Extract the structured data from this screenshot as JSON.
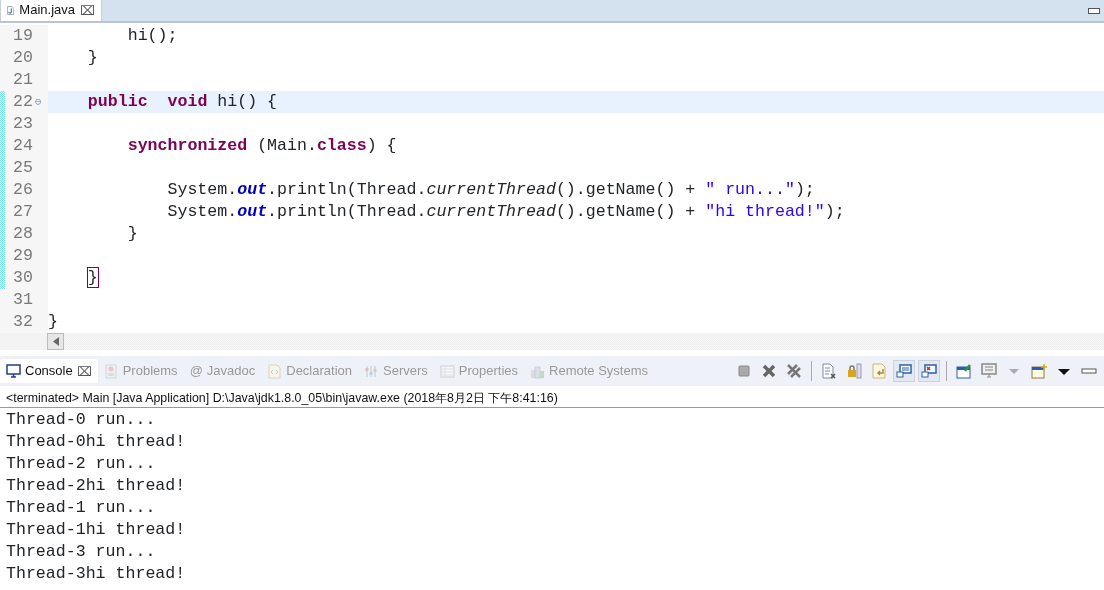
{
  "editor": {
    "tabs": [
      {
        "label": "Main.java",
        "selected": true,
        "close": "⌧"
      }
    ],
    "lines": [
      {
        "number": "19",
        "current": false,
        "changed": false,
        "tokens": [
          {
            "kind": "plain",
            "text": "        hi();"
          }
        ]
      },
      {
        "number": "20",
        "current": false,
        "changed": false,
        "tokens": [
          {
            "kind": "plain",
            "text": "    }"
          }
        ]
      },
      {
        "number": "21",
        "current": false,
        "changed": false
      },
      {
        "number": "22",
        "current": true,
        "changed": true,
        "fold": "⊖",
        "tokens": [
          {
            "kind": "keyword",
            "text": "    public"
          },
          {
            "kind": "keyword",
            "text": "  void"
          },
          {
            "kind": "plain",
            "text": " hi() {"
          }
        ]
      },
      {
        "number": "23",
        "current": false,
        "changed": true
      },
      {
        "number": "24",
        "current": false,
        "changed": true,
        "tokens": [
          {
            "kind": "keyword",
            "text": "        synchronized"
          },
          {
            "kind": "plain",
            "text": " (Main."
          },
          {
            "kind": "keyword",
            "text": "class"
          },
          {
            "kind": "plain",
            "text": ") {"
          }
        ]
      },
      {
        "number": "25",
        "current": false,
        "changed": true
      },
      {
        "number": "26",
        "current": false,
        "changed": true,
        "tokens": [
          {
            "kind": "plain",
            "text": "            System."
          },
          {
            "kind": "field",
            "text": "out"
          },
          {
            "kind": "plain",
            "text": ".println(Thread."
          },
          {
            "kind": "static",
            "text": "currentThread"
          },
          {
            "kind": "plain",
            "text": "().getName() + "
          },
          {
            "kind": "string",
            "text": "\" run...\""
          },
          {
            "kind": "plain",
            "text": ");"
          }
        ]
      },
      {
        "number": "27",
        "current": false,
        "changed": true,
        "tokens": [
          {
            "kind": "plain",
            "text": "            System."
          },
          {
            "kind": "field",
            "text": "out"
          },
          {
            "kind": "plain",
            "text": ".println(Thread."
          },
          {
            "kind": "static",
            "text": "currentThread"
          },
          {
            "kind": "plain",
            "text": "().getName() + "
          },
          {
            "kind": "string",
            "text": "\"hi thread!\""
          },
          {
            "kind": "plain",
            "text": ");"
          }
        ]
      },
      {
        "number": "28",
        "current": false,
        "changed": true,
        "tokens": [
          {
            "kind": "plain",
            "text": "        }"
          }
        ]
      },
      {
        "number": "29",
        "current": false,
        "changed": true
      },
      {
        "number": "30",
        "current": false,
        "changed": true,
        "tokens": [
          {
            "kind": "bracket",
            "text": "    }"
          }
        ]
      },
      {
        "number": "31",
        "current": false,
        "changed": false
      },
      {
        "number": "32",
        "current": false,
        "changed": false,
        "tokens": [
          {
            "kind": "plain",
            "text": "}"
          }
        ]
      }
    ]
  },
  "console": {
    "tabs": [
      {
        "label": "Console",
        "selected": true,
        "kind": "monitor",
        "close": "⌧"
      },
      {
        "label": "Problems",
        "selected": false,
        "kind": "problems"
      },
      {
        "label": "Javadoc",
        "selected": false,
        "kind": "glyph",
        "glyph": "@"
      },
      {
        "label": "Declaration",
        "selected": false,
        "kind": "declaration"
      },
      {
        "label": "Servers",
        "selected": false,
        "kind": "servers"
      },
      {
        "label": "Properties",
        "selected": false,
        "kind": "properties"
      },
      {
        "label": "Remote Systems",
        "selected": false,
        "kind": "remote"
      }
    ],
    "toolbar": [
      {
        "kind": "stop",
        "pressed": false
      },
      {
        "kind": "remove",
        "pressed": false
      },
      {
        "kind": "remove-all",
        "pressed": false
      },
      {
        "kind": "sep"
      },
      {
        "kind": "clear",
        "pressed": false
      },
      {
        "kind": "lock",
        "pressed": false
      },
      {
        "kind": "wrap",
        "pressed": false
      },
      {
        "kind": "show-out",
        "pressed": true
      },
      {
        "kind": "show-err",
        "pressed": true
      },
      {
        "kind": "sep"
      },
      {
        "kind": "pin",
        "pressed": false
      },
      {
        "kind": "display",
        "pressed": false
      },
      {
        "kind": "caret",
        "pressed": false
      },
      {
        "kind": "new",
        "pressed": false
      },
      {
        "kind": "menu",
        "pressed": false
      },
      {
        "kind": "minimize",
        "pressed": false
      }
    ],
    "status": "<terminated> Main [Java Application] D:\\Java\\jdk1.8.0_05\\bin\\javaw.exe (2018年8月2日 下午8:41:16)",
    "output": [
      "Thread-0 run...",
      "Thread-0hi thread!",
      "Thread-2 run...",
      "Thread-2hi thread!",
      "Thread-1 run...",
      "Thread-1hi thread!",
      "Thread-3 run...",
      "Thread-3hi thread!"
    ]
  }
}
